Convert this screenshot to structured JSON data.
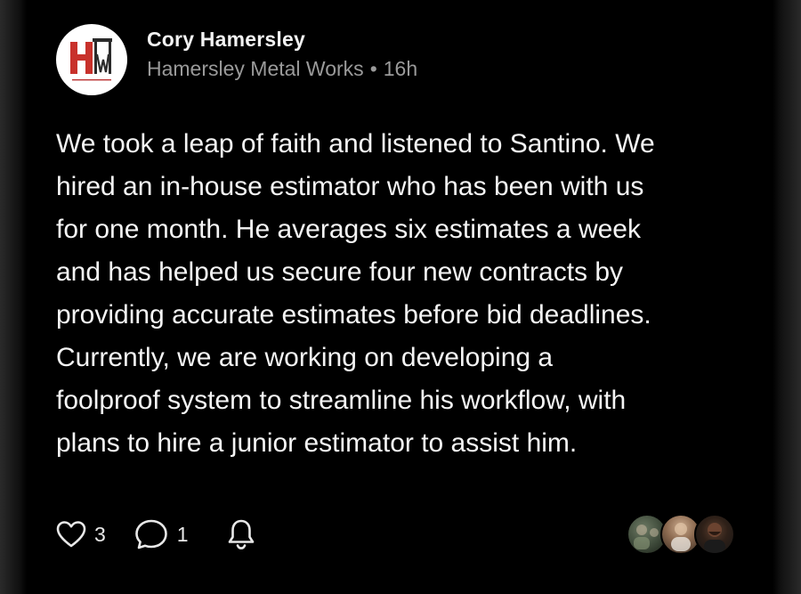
{
  "post": {
    "author": {
      "name": "Cory Hamersley",
      "avatar_icon": "hamersley-metal-works-logo-icon",
      "logo_letters": "HM",
      "logo_caption": "HAMERSLEY METAL WORKS"
    },
    "company": "Hamersley Metal Works",
    "separator": "•",
    "time_ago": "16h",
    "body_lines": [
      "We took a leap of faith and listened to Santino. We",
      "hired an in-house estimator who has been with us",
      "for one month. He averages six estimates a week",
      "and has helped us secure four new contracts by",
      "providing accurate estimates before bid deadlines.",
      "Currently, we are working on developing a",
      "foolproof system to streamline his workflow, with",
      "plans to hire a junior estimator to assist him."
    ]
  },
  "actions": {
    "like": {
      "icon": "heart-icon",
      "count": "3"
    },
    "comment": {
      "icon": "comment-bubble-icon",
      "count": "1"
    },
    "notify": {
      "icon": "bell-icon"
    }
  },
  "reactors": [
    {
      "icon": "reactor-avatar-1"
    },
    {
      "icon": "reactor-avatar-2"
    },
    {
      "icon": "reactor-avatar-3"
    }
  ],
  "colors": {
    "background": "#000000",
    "text_primary": "#f4f4f4",
    "text_secondary": "#9a9a9a",
    "logo_red": "#c8312b"
  }
}
